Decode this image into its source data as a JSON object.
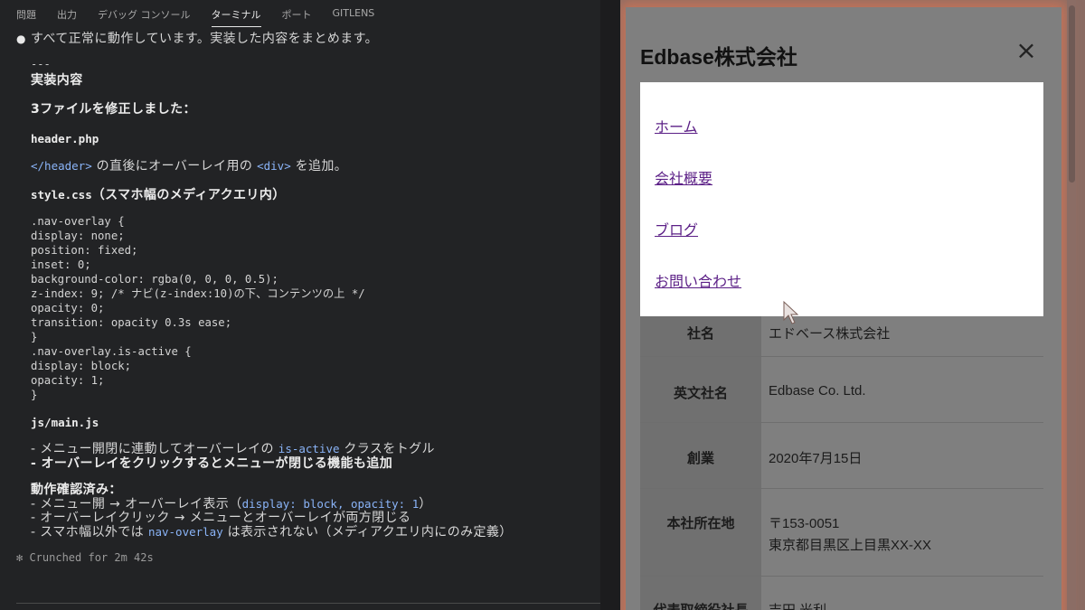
{
  "tabs": [
    "問題",
    "出力",
    "デバッグ コンソール",
    "ターミナル",
    "ポート",
    "GITLENS"
  ],
  "active_tab": "ターミナル",
  "terminal": {
    "summary": "すべて正常に動作しています。実装した内容をまとめます。",
    "separator": "---",
    "heading": "実装内容",
    "files_modified": "3ファイルを修正しました：",
    "file1": "header.php",
    "file1_desc_code1": "</header>",
    "file1_desc_mid": " の直後にオーバーレイ用の ",
    "file1_desc_code2": "<div>",
    "file1_desc_end": " を追加。",
    "file2": "style.css",
    "file2_note": "（スマホ幅のメディアクエリ内）",
    "css_lines": [
      ".nav-overlay {",
      "  display: none;",
      "  position: fixed;",
      "  inset: 0;",
      "  background-color: rgba(0, 0, 0, 0.5);",
      "  z-index: 9;  /* ナビ(z-index:10)の下、コンテンツの上 */",
      "  opacity: 0;",
      "  transition: opacity 0.3s ease;",
      "}",
      ".nav-overlay.is-active {",
      "  display: block;",
      "  opacity: 1;",
      "}"
    ],
    "file3": "js/main.js",
    "js_item1_pre": "- メニュー開閉に連動してオーバーレイの ",
    "js_item1_code": "is-active",
    "js_item1_post": " クラスをトグル",
    "js_item2": "- オーバーレイをクリックするとメニューが閉じる機能も追加",
    "confirm_heading": "動作確認済み：",
    "confirm1_pre": "- メニュー開 → オーバーレイ表示（",
    "confirm1_code": "display: block, opacity: 1",
    "confirm1_post": "）",
    "confirm2": "- オーバーレイクリック → メニューとオーバーレイが両方閉じる",
    "confirm3_pre": "- スマホ幅以外では ",
    "confirm3_code": "nav-overlay",
    "confirm3_post": " は表示されない（メディアクエリ内にのみ定義）",
    "crunched": "✻ Crunched for 2m 42s"
  },
  "site": {
    "title": "Edbase株式会社",
    "close_label": "×",
    "menu": [
      "ホーム",
      "会社概要",
      "ブログ",
      "お問い合わせ"
    ],
    "table": [
      {
        "label": "社名",
        "value": "エドベース株式会社"
      },
      {
        "label": "英文社名",
        "value": "Edbase Co. Ltd."
      },
      {
        "label": "創業",
        "value": "2020年7月15日"
      },
      {
        "label": "本社所在地",
        "value": "〒153-0051",
        "value2": "東京都目黒区上目黒XX-XX"
      },
      {
        "label": "代表取締役社長",
        "value": "吉田 光利"
      }
    ]
  },
  "colors": {
    "terminal_bg": "#222325",
    "link": "#5b1f86",
    "overlay_glow": "#c57459"
  }
}
